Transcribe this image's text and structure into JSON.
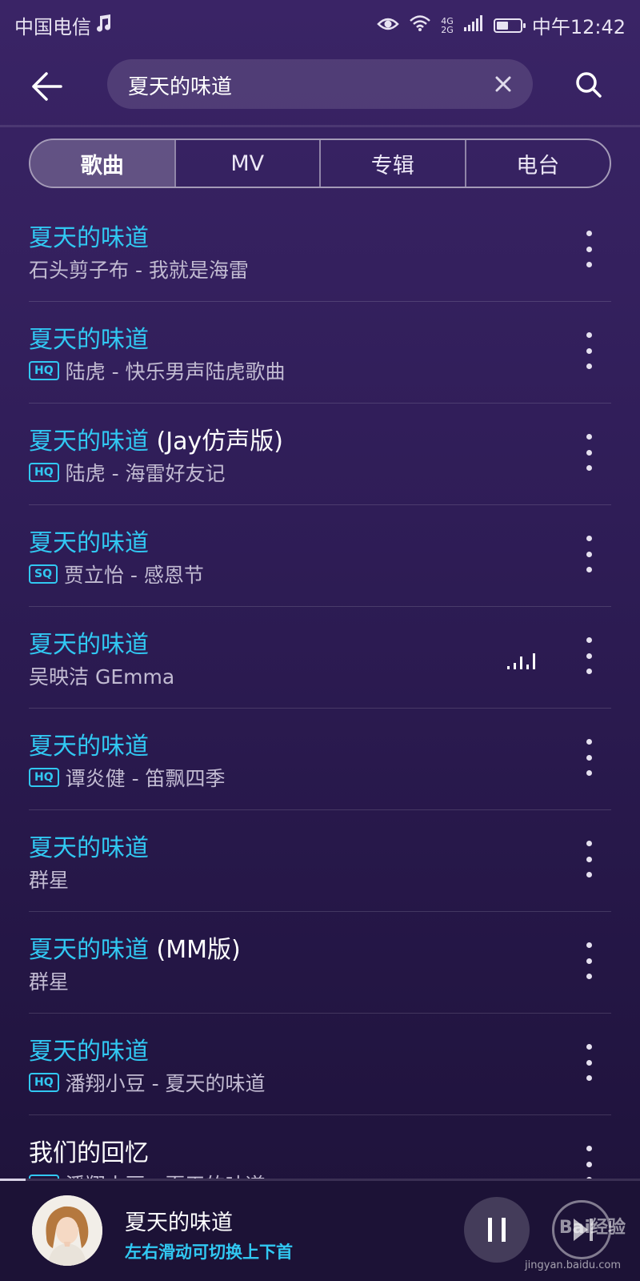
{
  "status_bar": {
    "carrier": "中国电信",
    "net_top": "4G",
    "net_bottom": "2G",
    "battery_level": 0.5,
    "time": "中午12:42"
  },
  "search": {
    "query": "夏天的味道"
  },
  "tabs": [
    {
      "label": "歌曲",
      "active": true
    },
    {
      "label": "MV",
      "active": false
    },
    {
      "label": "专辑",
      "active": false
    },
    {
      "label": "电台",
      "active": false
    }
  ],
  "songs": [
    {
      "title": "夏天的味道",
      "suffix": "",
      "badge": "",
      "subtitle": "石头剪子布 - 我就是海雷"
    },
    {
      "title": "夏天的味道",
      "suffix": "",
      "badge": "HQ",
      "subtitle": "陆虎 - 快乐男声陆虎歌曲"
    },
    {
      "title": "夏天的味道",
      "suffix": " (Jay仿声版)",
      "badge": "HQ",
      "subtitle": "陆虎 - 海雷好友记"
    },
    {
      "title": "夏天的味道",
      "suffix": "",
      "badge": "SQ",
      "subtitle": "贾立怡 - 感恩节"
    },
    {
      "title": "夏天的味道",
      "suffix": "",
      "badge": "",
      "subtitle": "吴映洁 GEmma",
      "playing": true
    },
    {
      "title": "夏天的味道",
      "suffix": "",
      "badge": "HQ",
      "subtitle": "谭炎健 - 笛飘四季"
    },
    {
      "title": "夏天的味道",
      "suffix": "",
      "badge": "",
      "subtitle": "群星"
    },
    {
      "title": "夏天的味道",
      "suffix": " (MM版)",
      "badge": "",
      "subtitle": "群星"
    },
    {
      "title": "夏天的味道",
      "suffix": "",
      "badge": "HQ",
      "subtitle": "潘翔小豆 - 夏天的味道"
    },
    {
      "title": "我们的回忆",
      "suffix": "",
      "badge": "HQ",
      "subtitle": "潘翔小豆 - 夏天的味道",
      "plain": true
    }
  ],
  "player": {
    "song": "夏天的味道",
    "hint": "左右滑动可切换上下首",
    "progress": 0.04
  },
  "watermark": {
    "brand": "Bai经验",
    "url": "jingyan.baidu.com"
  }
}
